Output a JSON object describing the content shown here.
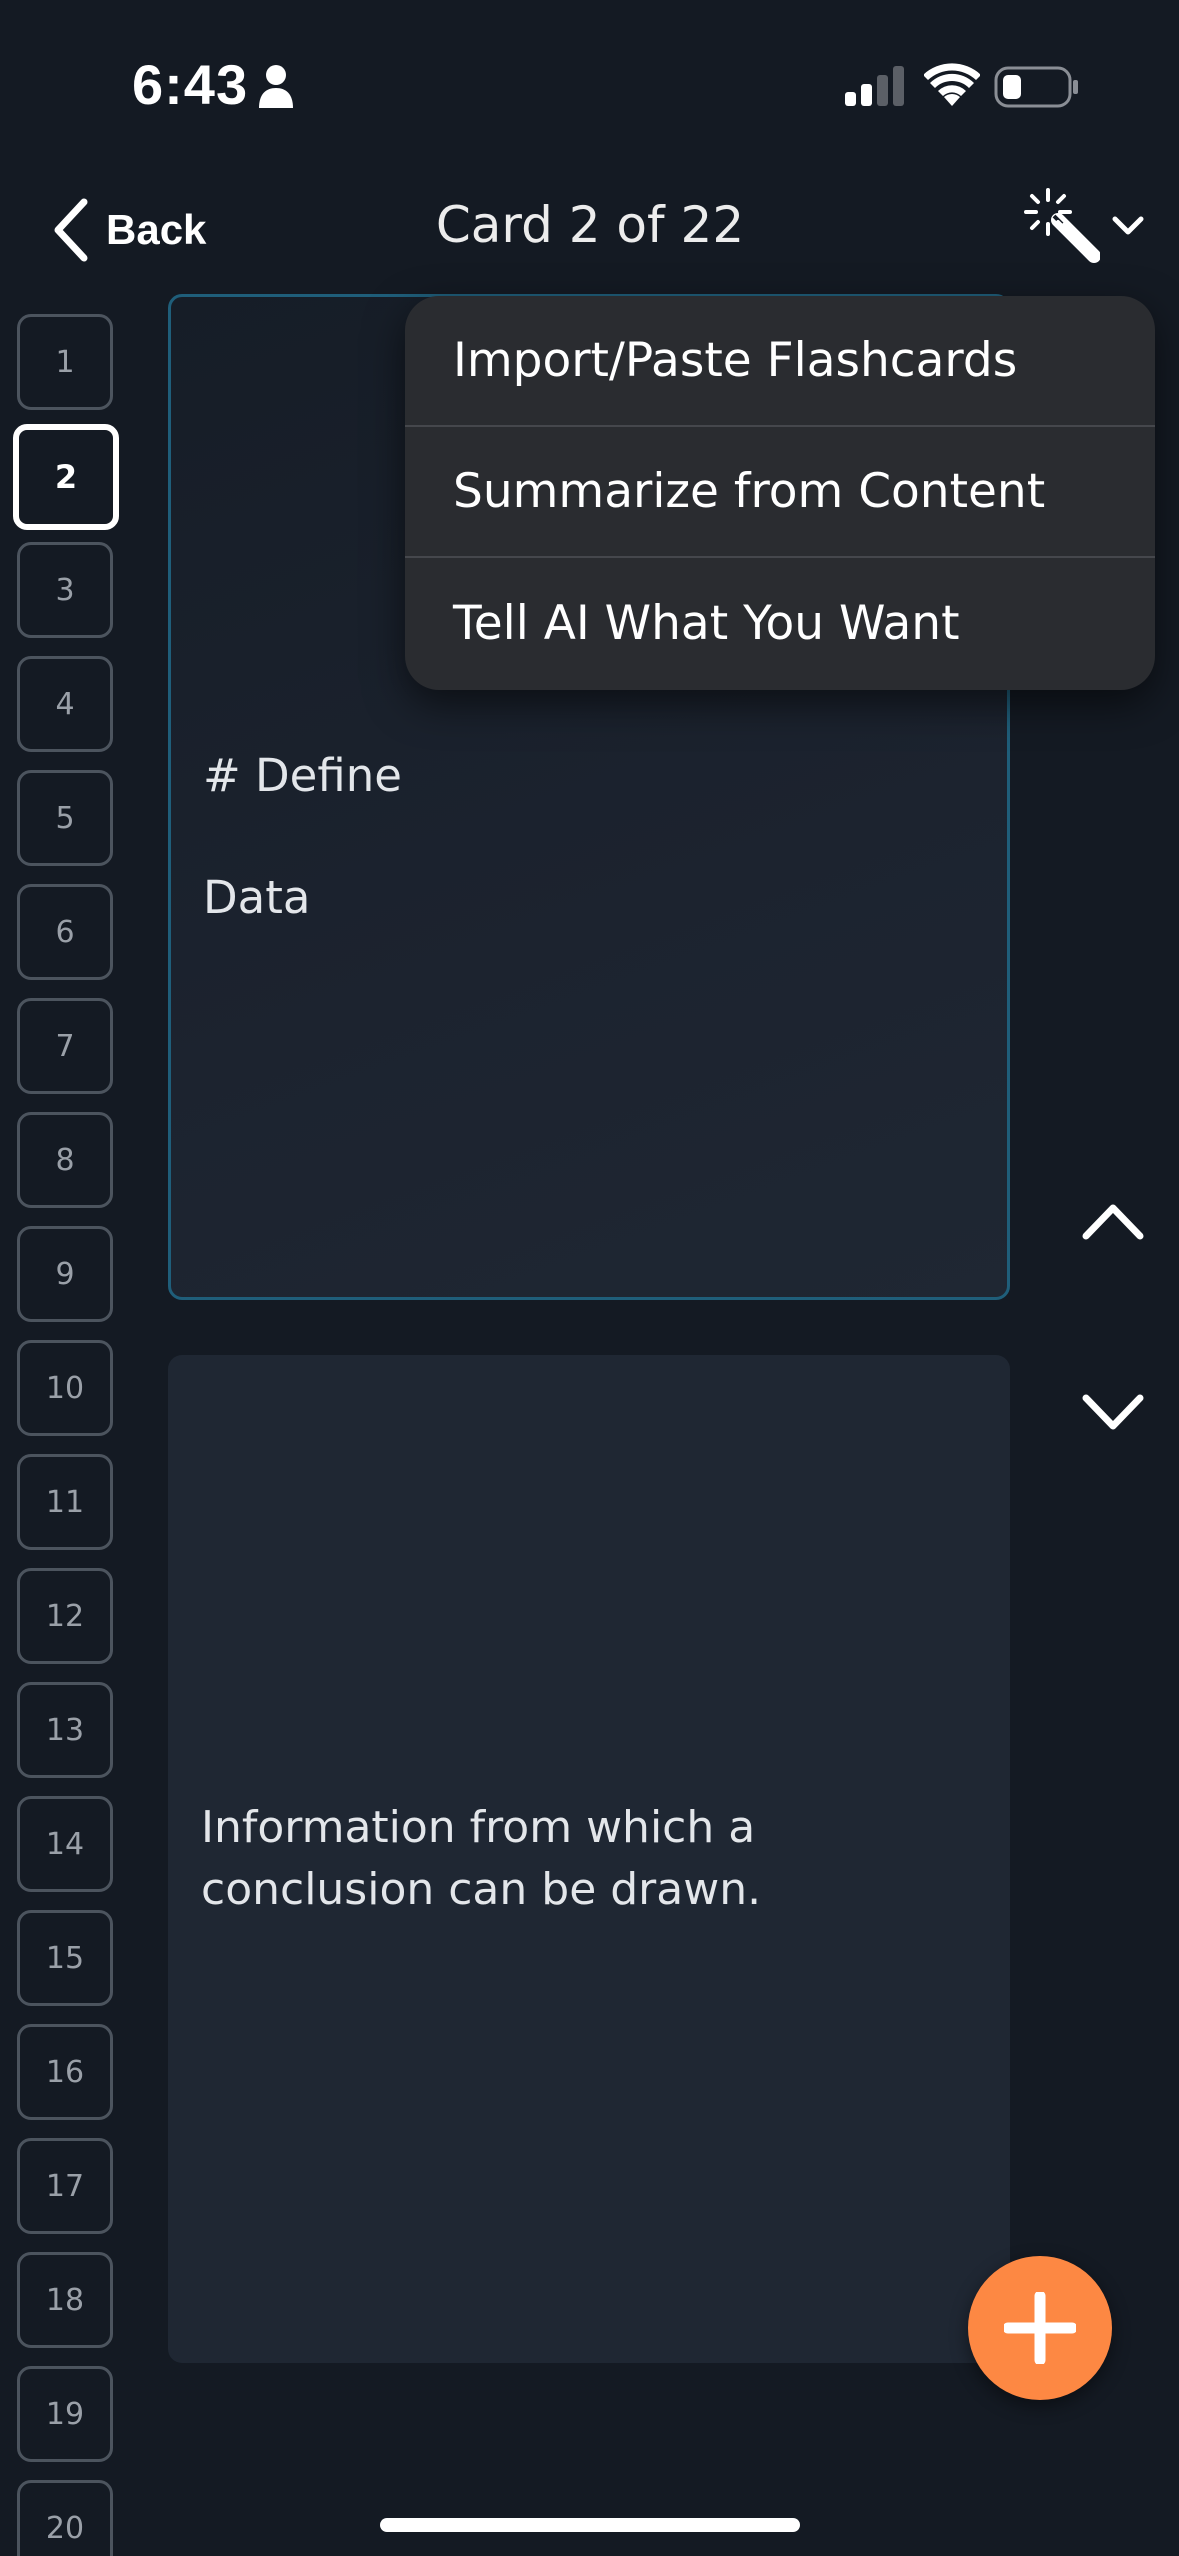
{
  "status_bar": {
    "time": "6:43"
  },
  "nav": {
    "back_label": "Back",
    "title": "Card 2 of 22"
  },
  "sidebar": {
    "numbers": [
      "1",
      "2",
      "3",
      "4",
      "5",
      "6",
      "7",
      "8",
      "9",
      "10",
      "11",
      "12",
      "13",
      "14",
      "15",
      "16",
      "17",
      "18",
      "19",
      "20"
    ],
    "active": "2"
  },
  "front_card": {
    "text": "# Define\nData"
  },
  "back_card": {
    "text": "Information from which a conclusion can be drawn."
  },
  "menu": {
    "items": [
      "Import/Paste Flashcards",
      "Summarize from Content",
      "Tell AI What You Want"
    ]
  },
  "colors": {
    "background": "#141a23",
    "card": "#1f2733",
    "card_border_selected": "#1f5e7a",
    "accent_fab": "#fd8843",
    "menu_background": "#2a2c30"
  },
  "icons": {
    "magic": "magic-wand-icon",
    "fab": "plus-icon",
    "nav_up": "chevron-up-icon",
    "nav_down": "chevron-down-icon"
  }
}
